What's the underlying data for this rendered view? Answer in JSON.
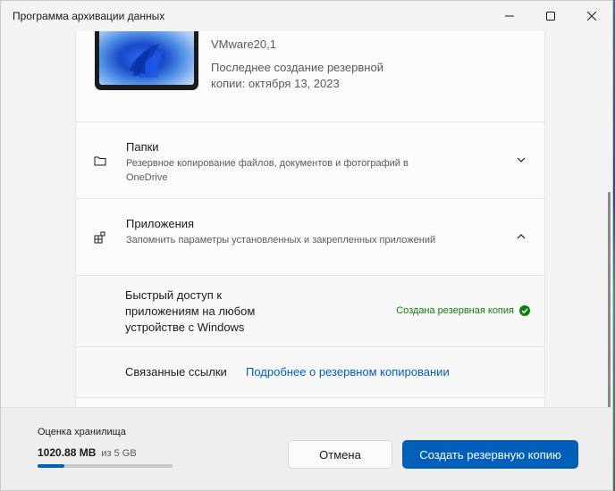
{
  "window": {
    "title": "Программа архивации данных",
    "controls": {
      "minimize": "—",
      "maximize": "☐",
      "close": "✕"
    }
  },
  "device": {
    "model": "VMware20,1",
    "last_backup": "Последнее создание резервной копии: октября 13, 2023"
  },
  "sections": {
    "folders": {
      "title": "Папки",
      "subtitle": "Резервное копирование файлов, документов и фотографий в OneDrive",
      "icon": "folder-icon",
      "expanded": false
    },
    "apps": {
      "title": "Приложения",
      "subtitle": "Запомнить параметры установленных и закрепленных приложений",
      "icon": "apps-icon",
      "expanded": true,
      "quick_access": {
        "label": "Быстрый доступ к приложениям на любом устройстве с Windows",
        "status": "Создана резервная копия",
        "status_color": "#0f7b0f"
      },
      "related": {
        "label": "Связанные ссылки",
        "link": "Подробнее о резервном копировании"
      }
    }
  },
  "footer": {
    "storage_label": "Оценка хранилища",
    "storage_used": "1020.88 MB",
    "storage_total": "из 5 GB",
    "storage_fraction": 0.2,
    "cancel_label": "Отмена",
    "create_label": "Создать резервную копию"
  },
  "colors": {
    "accent": "#005fb8",
    "success": "#0f7b0f"
  }
}
